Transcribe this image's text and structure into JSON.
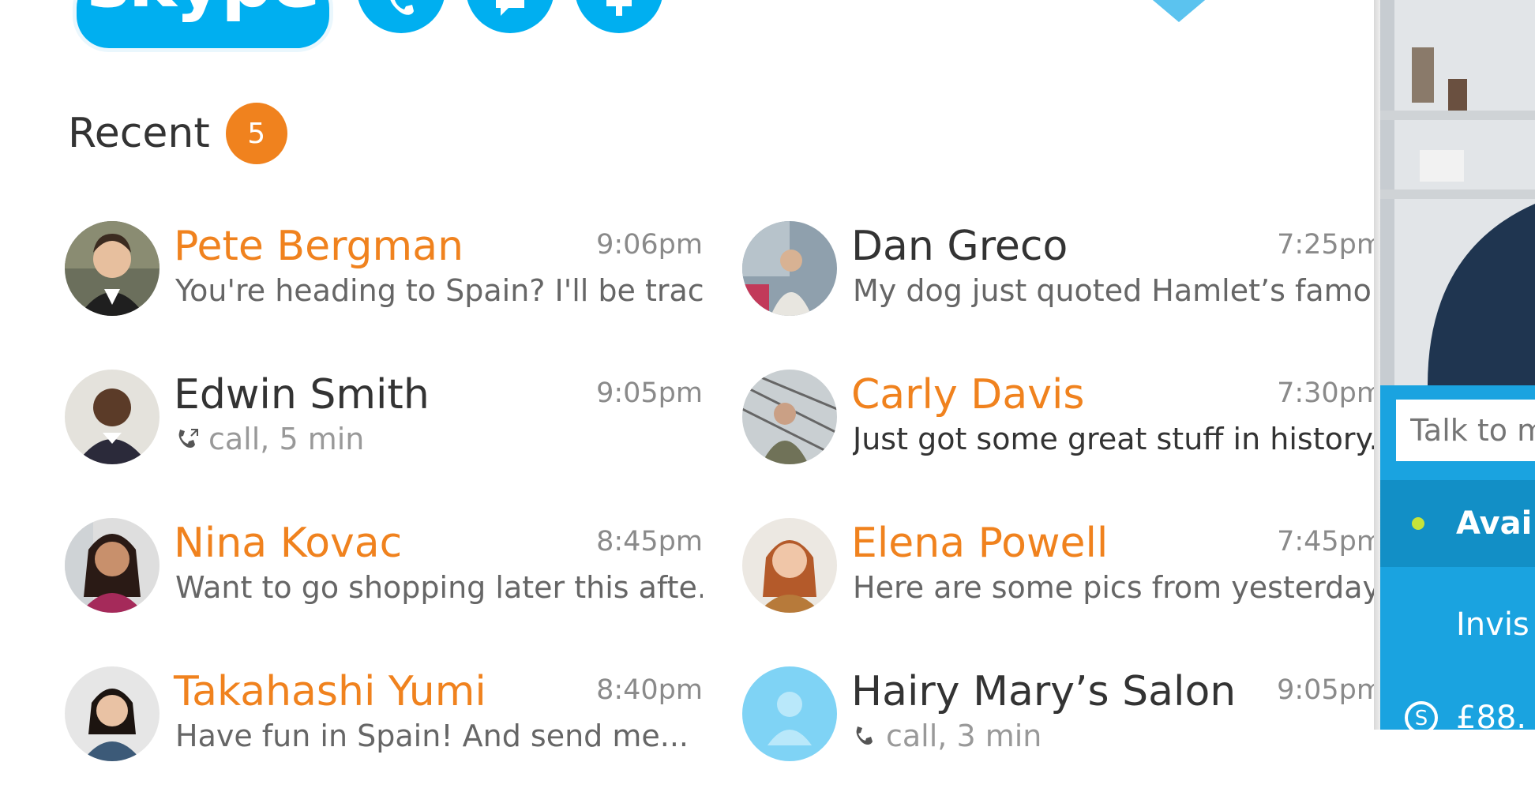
{
  "app": {
    "logo_text": "skype"
  },
  "recent": {
    "title": "Recent",
    "badge": "5"
  },
  "conversations_left": [
    {
      "name": "Pete Bergman",
      "time": "9:06pm",
      "preview": "You're heading to Spain? I'll be trac...",
      "unread": true
    },
    {
      "name": "Edwin Smith",
      "time": "9:05pm",
      "preview": "call, 5 min",
      "unread": false
    },
    {
      "name": "Nina Kovac",
      "time": "8:45pm",
      "preview": "Want to go shopping later this afte...",
      "unread": true
    },
    {
      "name": "Takahashi Yumi",
      "time": "8:40pm",
      "preview": "Have fun in Spain! And send me...",
      "unread": true
    }
  ],
  "conversations_right": [
    {
      "name": "Dan Greco",
      "time": "7:25pm",
      "preview": "My dog just quoted Hamlet’s famo...",
      "unread": false
    },
    {
      "name": "Carly Davis",
      "time": "7:30pm",
      "preview": "Just got some great stuff in history...",
      "unread": true
    },
    {
      "name": "Elena Powell",
      "time": "7:45pm",
      "preview": "Here are some pics from yesterday ...",
      "unread": true
    },
    {
      "name": "Hairy Mary’s Salon",
      "time": "9:05pm",
      "preview": "call, 3 min",
      "unread": false
    }
  ],
  "status_panel": {
    "mood_placeholder": "Talk to m",
    "available_label": "Avai",
    "invisible_label": "Invis",
    "credit_label": "£88."
  },
  "colors": {
    "brand": "#00aff0",
    "unread": "#f0821e",
    "panel": "#1aa3e0",
    "available_dot": "#c6e33a"
  }
}
